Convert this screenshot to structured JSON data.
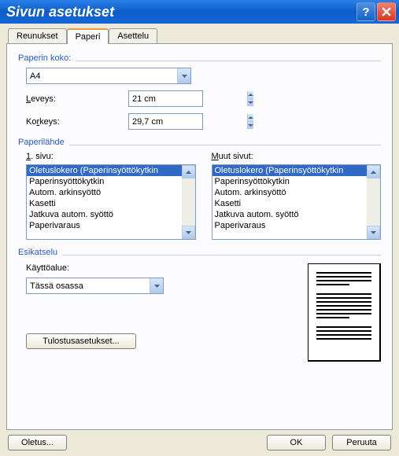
{
  "title": "Sivun asetukset",
  "tabs": {
    "margins": "Reunukset",
    "paper": "Paperi",
    "layout": "Asettelu"
  },
  "paper_size": {
    "group": "Paperin koko:",
    "selected": "A4",
    "width_label": "Leveys:",
    "width_value": "21 cm",
    "height_label": "Korkeys:",
    "height_value": "29,7 cm"
  },
  "paper_source": {
    "group": "Paperilähde",
    "first_page_label": "1. sivu:",
    "other_pages_label": "Muut sivut:",
    "options": [
      "Oletuslokero (Paperinsyöttökytkin",
      "Paperinsyöttökytkin",
      "Autom. arkinsyöttö",
      "Kasetti",
      "Jatkuva autom. syöttö",
      "Paperivaraus"
    ],
    "selected_index": 0
  },
  "preview": {
    "group": "Esikatselu",
    "scope_label": "Käyttöalue:",
    "scope_value": "Tässä osassa"
  },
  "buttons": {
    "print_settings": "Tulostusasetukset...",
    "default": "Oletus...",
    "ok": "OK",
    "cancel": "Peruuta"
  }
}
